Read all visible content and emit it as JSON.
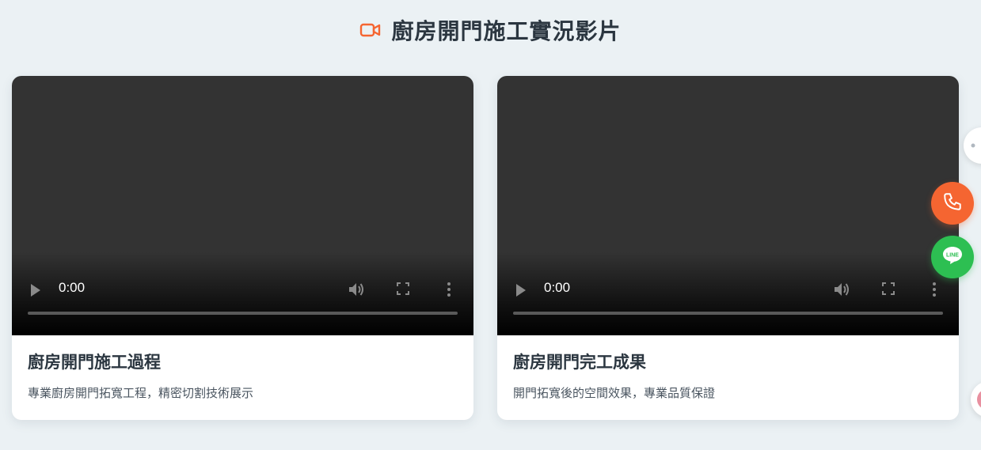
{
  "section": {
    "title": "廚房開門施工實況影片",
    "icon": "video-camera-icon",
    "accent_color": "#f56531"
  },
  "videos": [
    {
      "time": "0:00",
      "title": "廚房開門施工過程",
      "description": "專業廚房開門拓寬工程，精密切割技術展示"
    },
    {
      "time": "0:00",
      "title": "廚房開門完工成果",
      "description": "開門拓寬後的空間效果，專業品質保證"
    }
  ],
  "floating_actions": {
    "share_icon": "share-icon",
    "phone_icon": "phone-icon",
    "phone_color": "#f56531",
    "line_icon": "line-icon",
    "line_label": "LINE",
    "line_color": "#2dbf52",
    "chat_icon": "chat-avatar-icon"
  }
}
